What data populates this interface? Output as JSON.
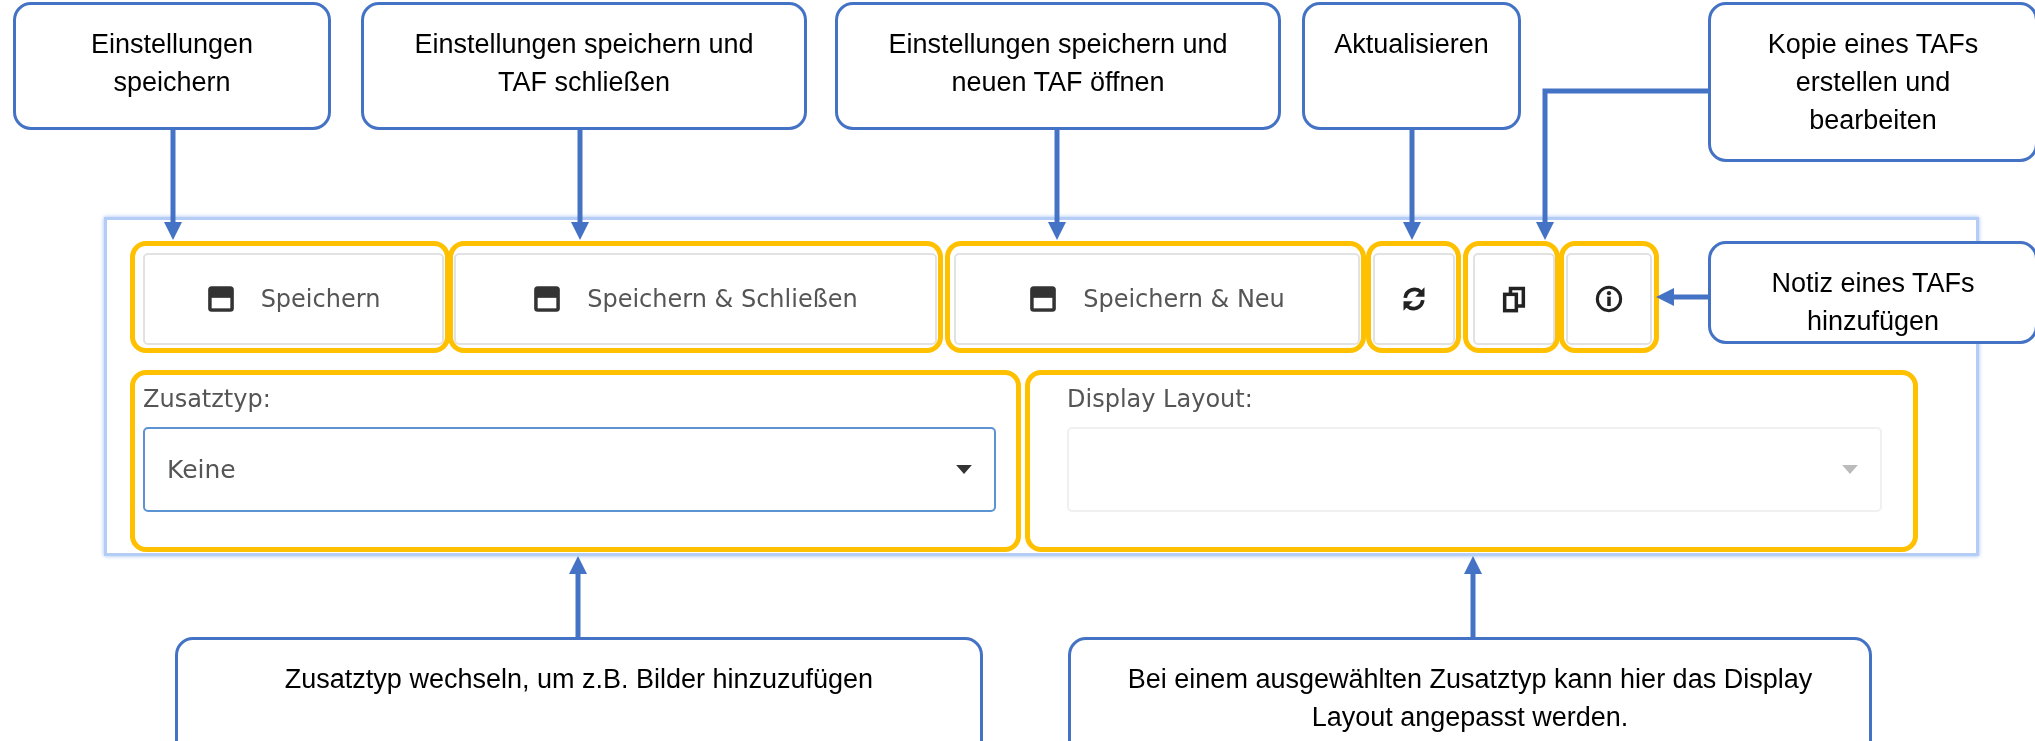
{
  "callouts": [
    {
      "text": "Einstellungen\nspeichern"
    },
    {
      "text": "Einstellungen speichern und\nTAF schließen"
    },
    {
      "text": "Einstellungen speichern und\nneuen TAF öffnen"
    },
    {
      "text": "Aktualisieren"
    },
    {
      "text": "Kopie eines TAFs\nerstellen und\nbearbeiten"
    },
    {
      "text": "Notiz eines TAFs\nhinzufügen"
    },
    {
      "text": "Zusatztyp wechseln, um z.B. Bilder hinzuzufügen"
    },
    {
      "text": "Bei einem ausgewählten Zusatztyp kann hier das Display\nLayout angepasst werden."
    }
  ],
  "toolbar": {
    "buttons": [
      {
        "kind": "save",
        "label": "Speichern"
      },
      {
        "kind": "save",
        "label": "Speichern & Schließen"
      },
      {
        "kind": "save",
        "label": "Speichern & Neu"
      },
      {
        "kind": "refresh"
      },
      {
        "kind": "copy"
      },
      {
        "kind": "info"
      }
    ]
  },
  "fields": [
    {
      "label": "Zusatztyp:",
      "value": "Keine",
      "focused": true,
      "disabled": false
    },
    {
      "label": "Display Layout:",
      "focused": false,
      "disabled": true
    }
  ]
}
